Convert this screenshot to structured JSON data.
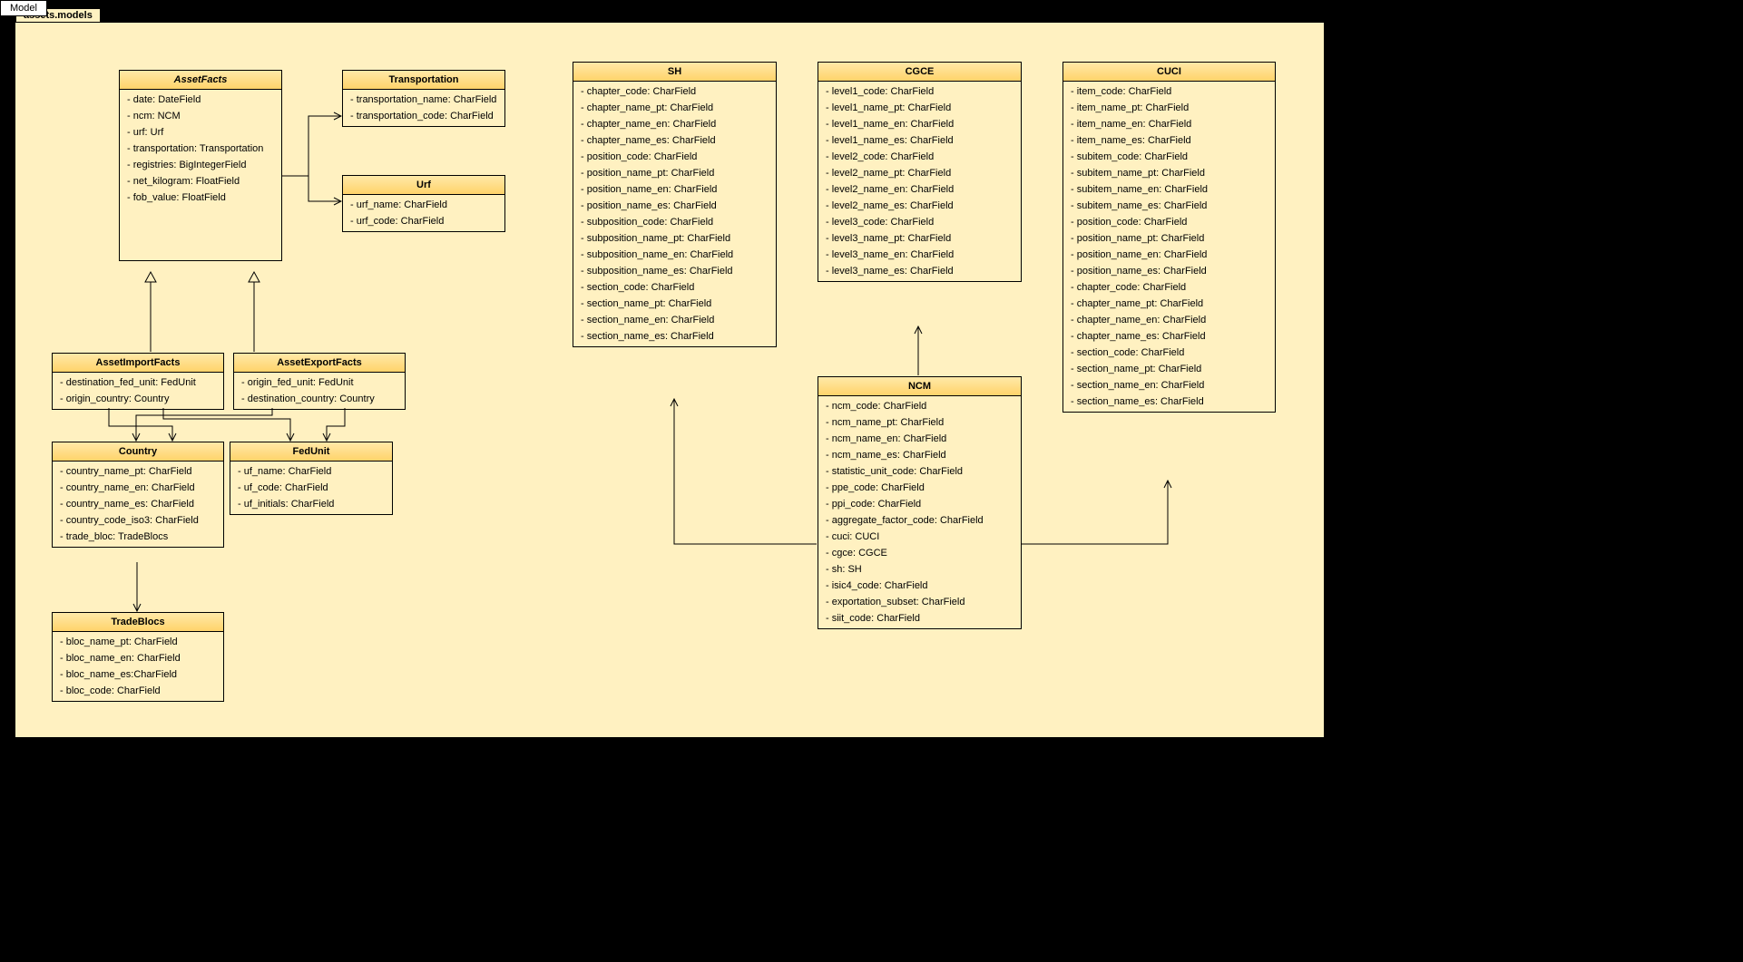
{
  "tab": {
    "label": "Model"
  },
  "package": {
    "name": "assets.models"
  },
  "classes": {
    "AssetFacts": {
      "title": "AssetFacts",
      "abstract": true,
      "attrs": [
        "- date: DateField",
        "- ncm: NCM",
        "- urf: Urf",
        "- transportation: Transportation",
        "- registries: BigIntegerField",
        "- net_kilogram: FloatField",
        "- fob_value: FloatField"
      ]
    },
    "Transportation": {
      "title": "Transportation",
      "attrs": [
        "- transportation_name: CharField",
        "- transportation_code: CharField"
      ]
    },
    "Urf": {
      "title": "Urf",
      "attrs": [
        "- urf_name: CharField",
        "- urf_code: CharField"
      ]
    },
    "AssetImportFacts": {
      "title": "AssetImportFacts",
      "attrs": [
        "- destination_fed_unit: FedUnit",
        "- origin_country: Country"
      ]
    },
    "AssetExportFacts": {
      "title": "AssetExportFacts",
      "attrs": [
        "- origin_fed_unit: FedUnit",
        "- destination_country: Country"
      ]
    },
    "Country": {
      "title": "Country",
      "attrs": [
        "- country_name_pt: CharField",
        "- country_name_en: CharField",
        "- country_name_es: CharField",
        "- country_code_iso3: CharField",
        "- trade_bloc: TradeBlocs"
      ]
    },
    "FedUnit": {
      "title": "FedUnit",
      "attrs": [
        "- uf_name: CharField",
        "- uf_code: CharField",
        "- uf_initials: CharField"
      ]
    },
    "TradeBlocs": {
      "title": "TradeBlocs",
      "attrs": [
        "- bloc_name_pt: CharField",
        "- bloc_name_en: CharField",
        "- bloc_name_es:CharField",
        "- bloc_code: CharField"
      ]
    },
    "SH": {
      "title": "SH",
      "attrs": [
        "- chapter_code: CharField",
        "- chapter_name_pt: CharField",
        "- chapter_name_en: CharField",
        "- chapter_name_es: CharField",
        "- position_code: CharField",
        "- position_name_pt: CharField",
        "- position_name_en: CharField",
        "- position_name_es: CharField",
        "- subposition_code: CharField",
        "- subposition_name_pt: CharField",
        "- subposition_name_en: CharField",
        "- subposition_name_es: CharField",
        "- section_code: CharField",
        "- section_name_pt: CharField",
        "- section_name_en: CharField",
        "- section_name_es: CharField"
      ]
    },
    "CGCE": {
      "title": "CGCE",
      "attrs": [
        "- level1_code: CharField",
        "- level1_name_pt: CharField",
        "- level1_name_en: CharField",
        "- level1_name_es: CharField",
        "- level2_code: CharField",
        "- level2_name_pt: CharField",
        "- level2_name_en: CharField",
        "- level2_name_es: CharField",
        "- level3_code: CharField",
        "- level3_name_pt: CharField",
        "- level3_name_en: CharField",
        "- level3_name_es: CharField"
      ]
    },
    "CUCI": {
      "title": "CUCI",
      "attrs": [
        "- item_code: CharField",
        "- item_name_pt: CharField",
        "- item_name_en: CharField",
        "- item_name_es: CharField",
        "- subitem_code: CharField",
        "- subitem_name_pt: CharField",
        "- subitem_name_en: CharField",
        "- subitem_name_es: CharField",
        "- position_code: CharField",
        "- position_name_pt: CharField",
        "- position_name_en: CharField",
        "- position_name_es: CharField",
        "- chapter_code: CharField",
        "- chapter_name_pt: CharField",
        "- chapter_name_en: CharField",
        "- chapter_name_es: CharField",
        "- section_code: CharField",
        "- section_name_pt: CharField",
        "- section_name_en: CharField",
        "- section_name_es: CharField"
      ]
    },
    "NCM": {
      "title": "NCM",
      "attrs": [
        "- ncm_code: CharField",
        "- ncm_name_pt: CharField",
        "- ncm_name_en: CharField",
        "- ncm_name_es: CharField",
        "- statistic_unit_code: CharField",
        "- ppe_code: CharField",
        "- ppi_code: CharField",
        "- aggregate_factor_code: CharField",
        "- cuci: CUCI",
        "- cgce: CGCE",
        "- sh: SH",
        "- isic4_code: CharField",
        "- exportation_subset: CharField",
        "- siit_code: CharField"
      ]
    }
  }
}
